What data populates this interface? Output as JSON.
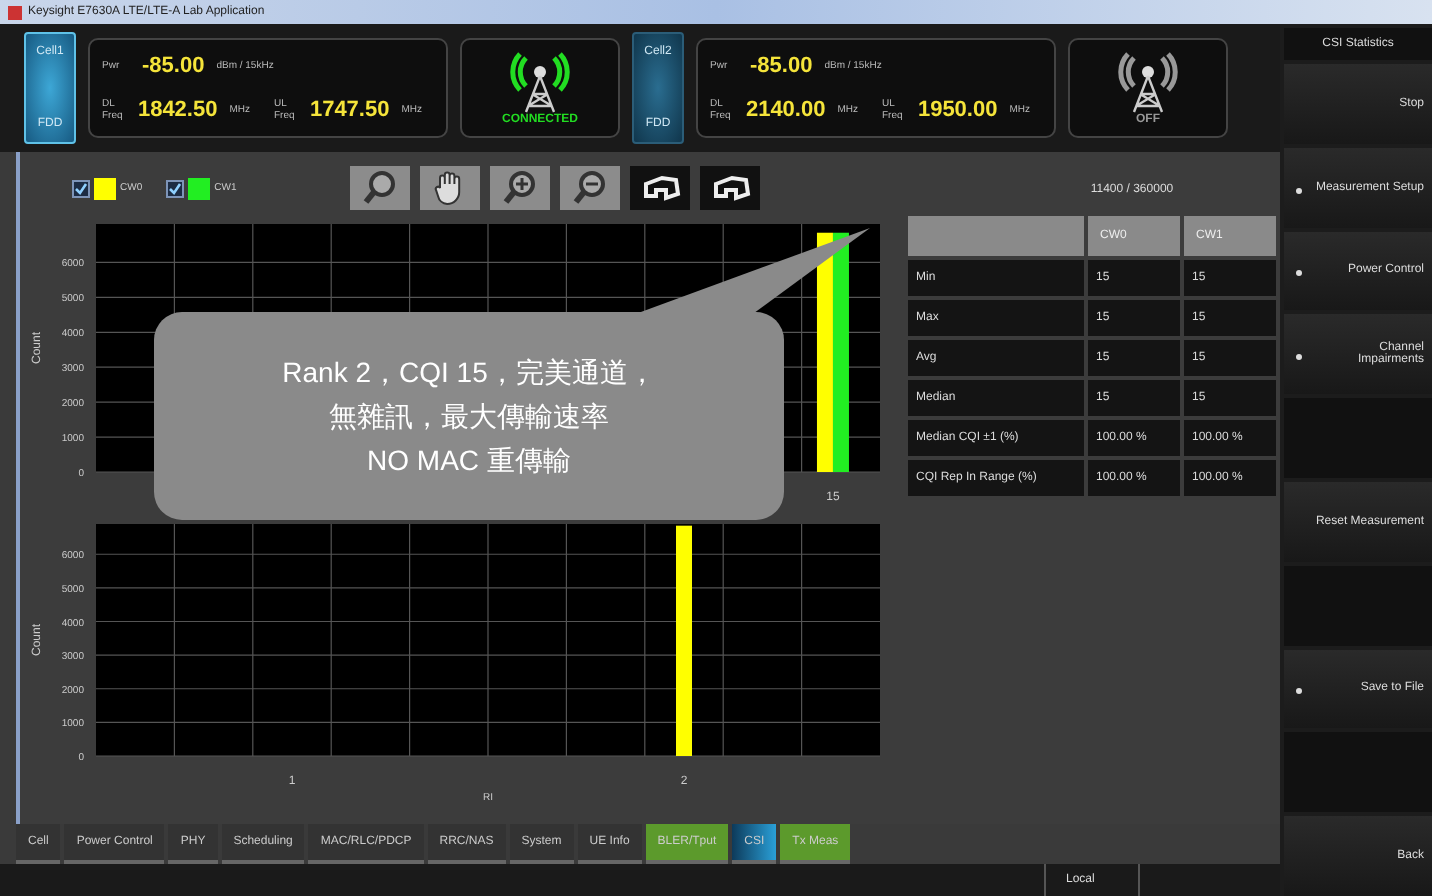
{
  "window": {
    "title": "Keysight E7630A LTE/LTE-A Lab Application"
  },
  "cells": [
    {
      "name": "Cell1",
      "duplex": "FDD",
      "selected": true,
      "pwr_label": "Pwr",
      "pwr": "-85.00",
      "pwr_unit": "dBm / 15kHz",
      "dl_label": "DL Freq",
      "dl": "1842.50",
      "dl_unit": "MHz",
      "ul_label": "UL Freq",
      "ul": "1747.50",
      "ul_unit": "MHz",
      "status": "CONNECTED",
      "connected": true
    },
    {
      "name": "Cell2",
      "duplex": "FDD",
      "selected": false,
      "pwr_label": "Pwr",
      "pwr": "-85.00",
      "pwr_unit": "dBm / 15kHz",
      "dl_label": "DL Freq",
      "dl": "2140.00",
      "dl_unit": "MHz",
      "ul_label": "UL Freq",
      "ul": "1950.00",
      "ul_unit": "MHz",
      "status": "OFF",
      "connected": false
    }
  ],
  "legend": [
    {
      "label": "CW0",
      "checked": true,
      "color": "#ffff00"
    },
    {
      "label": "CW1",
      "checked": true,
      "color": "#22ee22"
    }
  ],
  "toolbar": [
    {
      "kind": "zoom"
    },
    {
      "kind": "pan"
    },
    {
      "kind": "zoom-in"
    },
    {
      "kind": "zoom-out"
    },
    {
      "kind": "undo"
    },
    {
      "kind": "undo"
    }
  ],
  "counter": "11400 / 360000",
  "charts": [
    {
      "chart_data": {
        "type": "bar",
        "grid": true,
        "ylabel": "Count",
        "ylim": [
          0,
          7100
        ],
        "yticks": [
          0,
          1000,
          2000,
          3000,
          4000,
          5000,
          6000
        ],
        "annotations": [
          {
            "text": "15"
          }
        ],
        "series": [
          {
            "color": "#ffff00",
            "values": [
              6850
            ]
          },
          {
            "color": "#22ee22",
            "values": [
              6850
            ]
          }
        ]
      }
    },
    {
      "chart_data": {
        "type": "bar",
        "grid": true,
        "ylabel": "Count",
        "xlabel": "RI",
        "x": [
          2
        ],
        "xlim": [
          0.5,
          2.5
        ],
        "ylim": [
          0,
          6900
        ],
        "xticks": [
          1,
          2
        ],
        "yticks": [
          0,
          1000,
          2000,
          3000,
          4000,
          5000,
          6000
        ],
        "series": [
          {
            "color": "#ffff00",
            "values": [
              6850
            ]
          }
        ]
      }
    }
  ],
  "callout": {
    "lines": [
      "Rank 2，CQI 15，完美通道，",
      "無雜訊，最大傳輸速率",
      "NO MAC 重傳輸"
    ]
  },
  "table": {
    "columns": [
      "CW0",
      "CW1"
    ],
    "rows": [
      {
        "label": "Min",
        "values": [
          "15",
          "15"
        ]
      },
      {
        "label": "Max",
        "values": [
          "15",
          "15"
        ]
      },
      {
        "label": "Avg",
        "values": [
          "15",
          "15"
        ]
      },
      {
        "label": "Median",
        "values": [
          "15",
          "15"
        ]
      },
      {
        "label": "Median CQI ±1 (%)",
        "values": [
          "100.00 %",
          "100.00 %"
        ]
      },
      {
        "label": "CQI Rep In Range (%)",
        "values": [
          "100.00 %",
          "100.00 %"
        ]
      }
    ]
  },
  "tabs": [
    {
      "label": "Cell",
      "kind": "plain",
      "selected": false
    },
    {
      "label": "Power Control",
      "kind": "plain",
      "selected": false
    },
    {
      "label": "PHY",
      "kind": "plain",
      "selected": false
    },
    {
      "label": "Scheduling",
      "kind": "plain",
      "selected": false
    },
    {
      "label": "MAC/RLC/PDCP",
      "kind": "plain",
      "selected": false
    },
    {
      "label": "RRC/NAS",
      "kind": "plain",
      "selected": false
    },
    {
      "label": "System",
      "kind": "plain",
      "selected": false
    },
    {
      "label": "UE Info",
      "kind": "plain",
      "selected": false
    },
    {
      "label": "BLER/Tput",
      "kind": "green",
      "selected": false
    },
    {
      "label": "CSI",
      "kind": "plain",
      "selected": true
    },
    {
      "label": "Tx Meas",
      "kind": "green",
      "selected": false
    }
  ],
  "softkeys": {
    "title": "CSI Statistics",
    "keys": [
      {
        "kind": "action",
        "label": "Stop"
      },
      {
        "kind": "menu",
        "label": "Measurement Setup"
      },
      {
        "kind": "menu",
        "label": "Power Control"
      },
      {
        "kind": "menu",
        "label": "Channel Impairments"
      },
      {
        "kind": "blank"
      },
      {
        "kind": "action",
        "label": "Reset Measurement"
      },
      {
        "kind": "blank"
      },
      {
        "kind": "menu",
        "label": "Save to File"
      },
      {
        "kind": "blank"
      },
      {
        "kind": "action",
        "label": "Back"
      }
    ]
  },
  "status_bar": {
    "mode": "Local"
  }
}
